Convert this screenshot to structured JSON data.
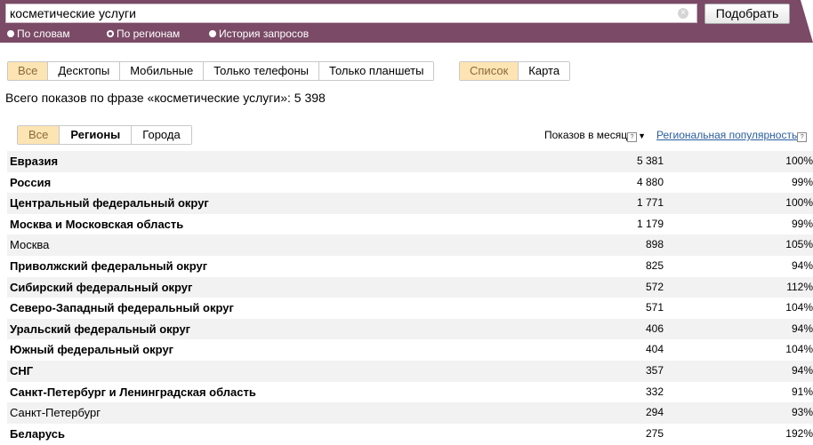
{
  "search": {
    "query": "косметические услуги",
    "clear_glyph": "×",
    "submit_label": "Подобрать"
  },
  "modes": [
    {
      "label": "По словам",
      "selected": false
    },
    {
      "label": "По регионам",
      "selected": true
    },
    {
      "label": "История запросов",
      "selected": false
    }
  ],
  "device_tabs": [
    "Все",
    "Десктопы",
    "Мобильные",
    "Только телефоны",
    "Только планшеты"
  ],
  "device_tabs_active": "Все",
  "view_tabs": [
    "Список",
    "Карта"
  ],
  "view_tabs_active": "Список",
  "summary": "Всего показов по фразе «косметические услуги»: 5 398",
  "region_tabs": [
    "Все",
    "Регионы",
    "Города"
  ],
  "region_tabs_active": "Все",
  "columns": {
    "shows": "Показов в месяц",
    "popularity": "Региональная популярность",
    "help_glyph": "?",
    "sort_glyph": "▼"
  },
  "rows": [
    {
      "name": "Евразия",
      "bold": true,
      "shows": "5 381",
      "popularity": "100%"
    },
    {
      "name": "Россия",
      "bold": true,
      "shows": "4 880",
      "popularity": "99%"
    },
    {
      "name": "Центральный федеральный округ",
      "bold": true,
      "shows": "1 771",
      "popularity": "100%"
    },
    {
      "name": "Москва и Московская область",
      "bold": true,
      "shows": "1 179",
      "popularity": "99%"
    },
    {
      "name": "Москва",
      "bold": false,
      "shows": "898",
      "popularity": "105%"
    },
    {
      "name": "Приволжский федеральный округ",
      "bold": true,
      "shows": "825",
      "popularity": "94%"
    },
    {
      "name": "Сибирский федеральный округ",
      "bold": true,
      "shows": "572",
      "popularity": "112%"
    },
    {
      "name": "Северо-Западный федеральный округ",
      "bold": true,
      "shows": "571",
      "popularity": "104%"
    },
    {
      "name": "Уральский федеральный округ",
      "bold": true,
      "shows": "406",
      "popularity": "94%"
    },
    {
      "name": "Южный федеральный округ",
      "bold": true,
      "shows": "404",
      "popularity": "104%"
    },
    {
      "name": "СНГ",
      "bold": true,
      "shows": "357",
      "popularity": "94%"
    },
    {
      "name": "Санкт-Петербург и Ленинградская область",
      "bold": true,
      "shows": "332",
      "popularity": "91%"
    },
    {
      "name": "Санкт-Петербург",
      "bold": false,
      "shows": "294",
      "popularity": "93%"
    },
    {
      "name": "Беларусь",
      "bold": true,
      "shows": "275",
      "popularity": "192%"
    }
  ],
  "colors": {
    "header_bg": "#7a4a66",
    "active_tab_bg": "#fde4b3",
    "link": "#2a5d9f",
    "row_alt": "#f2f2f2"
  }
}
